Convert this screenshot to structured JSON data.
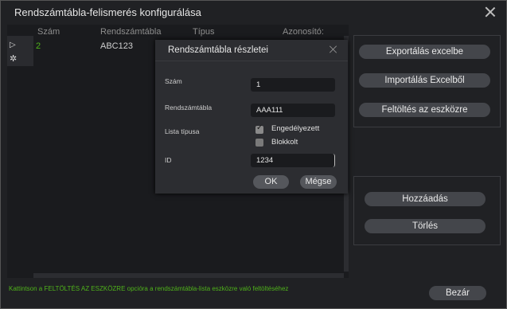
{
  "window": {
    "title": "Rendszámtábla-felismerés konfigurálása"
  },
  "table": {
    "columns": [
      "Szám",
      "Rendszámtábla",
      "Típus",
      "Azonosító:"
    ],
    "rows": [
      {
        "num": "2",
        "plate": "ABC123",
        "type": "",
        "id": ""
      }
    ]
  },
  "panel": {
    "export": "Exportálás excelbe",
    "import": "Importálás Excelből",
    "upload": "Feltöltés az eszközre",
    "add": "Hozzáadás",
    "delete": "Törlés"
  },
  "hint": "Kattintson a FELTÖLTÉS AZ ESZKÖZRE opcióra a rendszámtábla-lista eszközre való feltöltéséhez",
  "close_button": "Bezár",
  "dialog": {
    "title": "Rendszámtábla részletei",
    "num_label": "Szám",
    "num_value": "1",
    "plate_label": "Rendszámtábla",
    "plate_value": "AAA111",
    "list_type_label": "Lista típusa",
    "allow_label": "Engedélyezett",
    "allow_checked": true,
    "block_label": "Blokkolt",
    "block_checked": false,
    "id_label": "ID",
    "id_value": "1234",
    "ok": "OK",
    "cancel": "Mégse"
  },
  "colors": {
    "accent_green": "#4fb31a",
    "background": "#202124"
  },
  "icons": [
    "close-icon",
    "row-arrow-icon",
    "new-row-icon",
    "check-icon"
  ]
}
